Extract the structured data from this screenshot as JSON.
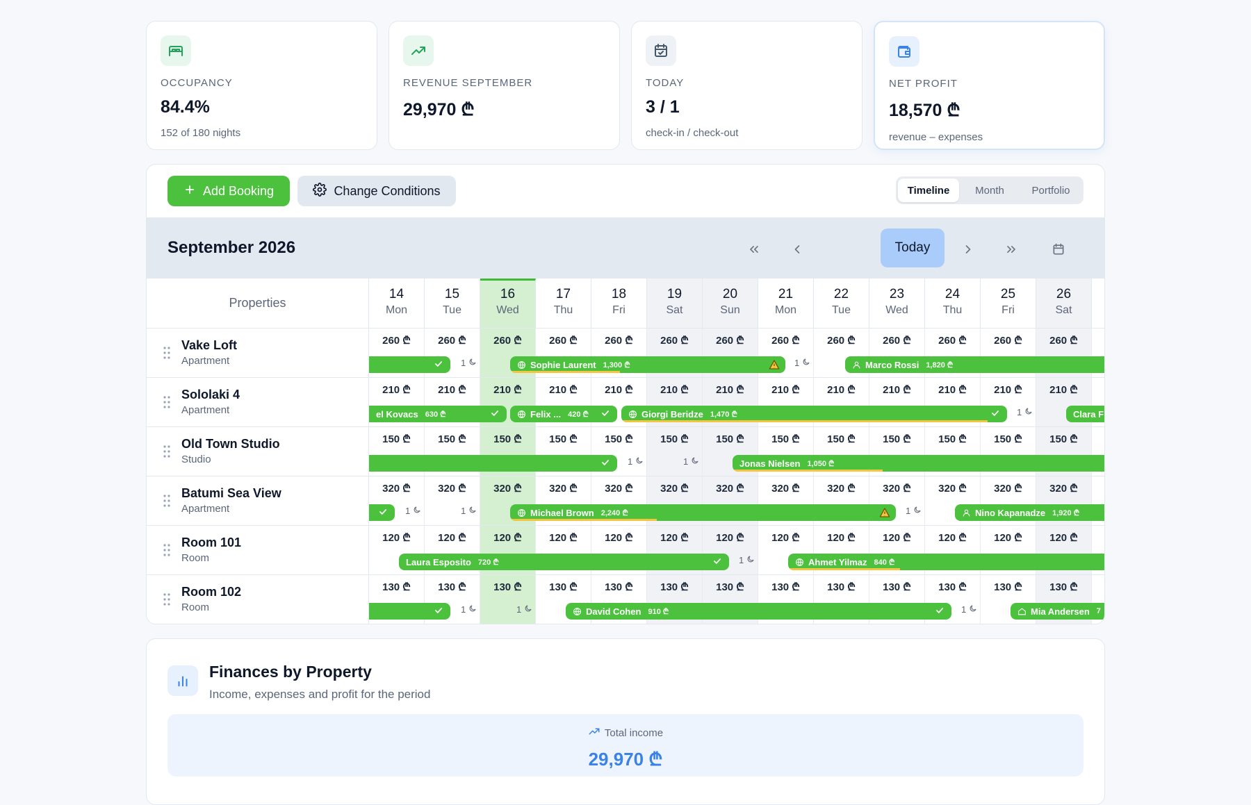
{
  "stats": [
    {
      "icon": "bed-icon",
      "label": "OCCUPANCY",
      "value": "84.4%",
      "sub": "152 of 180 nights"
    },
    {
      "icon": "trending-up-icon",
      "label": "REVENUE SEPTEMBER",
      "value": "29,970 ₾",
      "sub": ""
    },
    {
      "icon": "calendar-check-icon",
      "label": "TODAY",
      "value": "3 / 1",
      "sub": "check-in / check-out"
    },
    {
      "icon": "wallet-icon",
      "label": "NET PROFIT",
      "value": "18,570 ₾",
      "sub": "revenue – expenses"
    }
  ],
  "toolbar": {
    "add_booking": "Add Booking",
    "change_conditions": "Change Conditions",
    "views": [
      "Timeline",
      "Month",
      "Portfolio"
    ],
    "active_view": "Timeline"
  },
  "calendar": {
    "month_title": "September 2026",
    "today_label": "Today",
    "properties_header": "Properties",
    "days": [
      {
        "n": "14",
        "w": "Mon"
      },
      {
        "n": "15",
        "w": "Tue"
      },
      {
        "n": "16",
        "w": "Wed",
        "today": true
      },
      {
        "n": "17",
        "w": "Thu"
      },
      {
        "n": "18",
        "w": "Fri"
      },
      {
        "n": "19",
        "w": "Sat",
        "weekend": true
      },
      {
        "n": "20",
        "w": "Sun",
        "weekend": true
      },
      {
        "n": "21",
        "w": "Mon"
      },
      {
        "n": "22",
        "w": "Tue"
      },
      {
        "n": "23",
        "w": "Wed"
      },
      {
        "n": "24",
        "w": "Thu"
      },
      {
        "n": "25",
        "w": "Fri"
      },
      {
        "n": "26",
        "w": "Sat",
        "weekend": true
      }
    ],
    "properties": [
      {
        "name": "Vake Loft",
        "type": "Apartment",
        "price": "260 ₾"
      },
      {
        "name": "Sololaki 4",
        "type": "Apartment",
        "price": "210 ₾"
      },
      {
        "name": "Old Town Studio",
        "type": "Studio",
        "price": "150 ₾"
      },
      {
        "name": "Batumi Sea View",
        "type": "Apartment",
        "price": "320 ₾"
      },
      {
        "name": "Room 101",
        "type": "Room",
        "price": "120 ₾"
      },
      {
        "name": "Room 102",
        "type": "Room",
        "price": "130 ₾"
      }
    ],
    "gap_label": "1",
    "bookings": [
      [
        {
          "guest": "",
          "amount": "",
          "check": true
        },
        {
          "guest": "Sophie Laurent",
          "amount": "1,300 ₾",
          "icon": "globe-icon",
          "warn": true
        },
        {
          "guest": "Marco Rossi",
          "amount": "1,820 ₾",
          "icon": "user-icon"
        }
      ],
      [
        {
          "guest": "el Kovacs",
          "amount": "630 ₾",
          "check": true
        },
        {
          "guest": "Felix ...",
          "amount": "420 ₾",
          "icon": "globe-icon",
          "check": true
        },
        {
          "guest": "Giorgi Beridze",
          "amount": "1,470 ₾",
          "icon": "globe-icon",
          "check": true
        },
        {
          "guest": "Clara F",
          "amount": ""
        }
      ],
      [
        {
          "guest": "",
          "amount": "",
          "check": true
        },
        {
          "guest": "Jonas Nielsen",
          "amount": "1,050 ₾"
        }
      ],
      [
        {
          "guest": "",
          "amount": "",
          "check": true
        },
        {
          "guest": "Michael Brown",
          "amount": "2,240 ₾",
          "icon": "globe-icon",
          "warn": true
        },
        {
          "guest": "Nino Kapanadze",
          "amount": "1,920 ₾",
          "icon": "user-icon"
        }
      ],
      [
        {
          "guest": "Laura Esposito",
          "amount": "720 ₾",
          "check": true
        },
        {
          "guest": "Ahmet Yilmaz",
          "amount": "840 ₾",
          "icon": "globe-icon"
        }
      ],
      [
        {
          "guest": "",
          "amount": "",
          "check": true
        },
        {
          "guest": "David Cohen",
          "amount": "910 ₾",
          "icon": "globe-icon",
          "check": true
        },
        {
          "guest": "Mia Andersen",
          "amount": "7",
          "icon": "home-icon"
        }
      ]
    ]
  },
  "finances": {
    "title": "Finances by Property",
    "subtitle": "Income, expenses and profit for the period",
    "total_label": "Total income",
    "total_value": "29,970 ₾"
  },
  "colors": {
    "accent_green": "#4cc13d",
    "today_column": "#d4f0d0",
    "blue": "#3b82e6"
  }
}
